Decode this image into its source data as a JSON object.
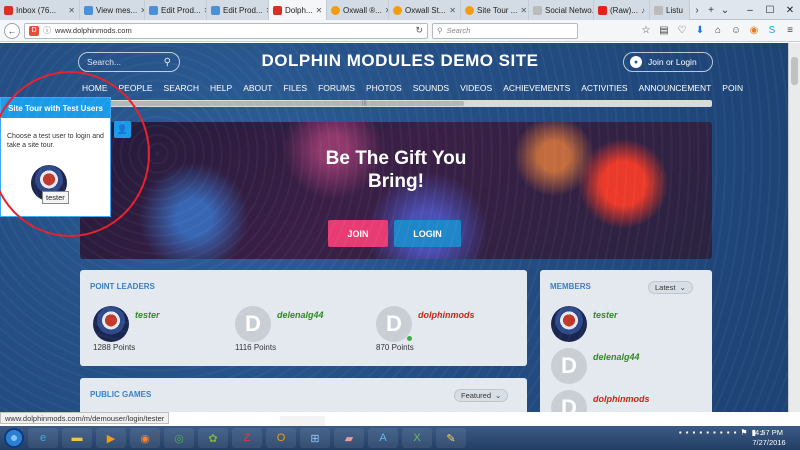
{
  "browser": {
    "tabs": [
      {
        "title": "Inbox (76...",
        "color": "#d93025",
        "active": false
      },
      {
        "title": "View mes...",
        "color": "#4a90d9",
        "active": false
      },
      {
        "title": "Edit Prod...",
        "color": "#4a90d9",
        "active": false
      },
      {
        "title": "Edit Prod...",
        "color": "#4a90d9",
        "active": false
      },
      {
        "title": "Dolph...",
        "color": "#d93025",
        "active": true
      },
      {
        "title": "Oxwall ®...",
        "color": "#f39c12",
        "active": false
      },
      {
        "title": "Oxwall St...",
        "color": "#f39c12",
        "active": false
      },
      {
        "title": "Site Tour ...",
        "color": "#f39c12",
        "active": false
      },
      {
        "title": "Social Netwo...",
        "color": "#bbbbbb",
        "active": false
      },
      {
        "title": "(Raw)...",
        "color": "#e62117",
        "active": false
      },
      {
        "title": "Listu",
        "color": "#bbbbbb",
        "active": false
      }
    ],
    "url": "www.dolphinmods.com",
    "search_placeholder": "Search",
    "status_url": "www.dolphinmods.com/m/demouser/login/tester"
  },
  "site": {
    "search_placeholder": "Search...",
    "title": "DOLPHIN MODULES DEMO SITE",
    "join_login": "Join or Login",
    "nav": [
      "HOME",
      "PEOPLE",
      "SEARCH",
      "HELP",
      "ABOUT",
      "FILES",
      "FORUMS",
      "PHOTOS",
      "SOUNDS",
      "VIDEOS",
      "ACHIEVEMENTS",
      "ACTIVITIES",
      "ANNOUNCEMENT",
      "POIN"
    ]
  },
  "hero": {
    "title_line1": "Be The Gift You",
    "title_line2": "Bring!",
    "join": "JOIN",
    "login": "LOGIN"
  },
  "point_leaders": {
    "title": "POINT LEADERS",
    "users": [
      {
        "name": "tester",
        "points": "1288 Points",
        "avatar": "photo",
        "color": "green"
      },
      {
        "name": "delenalg44",
        "points": "1116 Points",
        "avatar": "D",
        "color": "green"
      },
      {
        "name": "dolphinmods",
        "points": "870 Points",
        "avatar": "D",
        "color": "red"
      }
    ]
  },
  "members": {
    "title": "MEMBERS",
    "sort": "Latest",
    "users": [
      {
        "name": "tester",
        "avatar": "photo",
        "color": "green"
      },
      {
        "name": "delenalg44",
        "avatar": "D",
        "color": "green"
      },
      {
        "name": "dolphinmods",
        "avatar": "D",
        "color": "red"
      }
    ]
  },
  "public_games": {
    "title": "PUBLIC GAMES",
    "sort": "Featured"
  },
  "tour": {
    "title": "Site Tour with Test Users",
    "text": "Choose a test user to login and take a site tour.",
    "tooltip": "tester"
  },
  "taskbar": {
    "time": "4:57 PM",
    "date": "7/27/2016"
  }
}
